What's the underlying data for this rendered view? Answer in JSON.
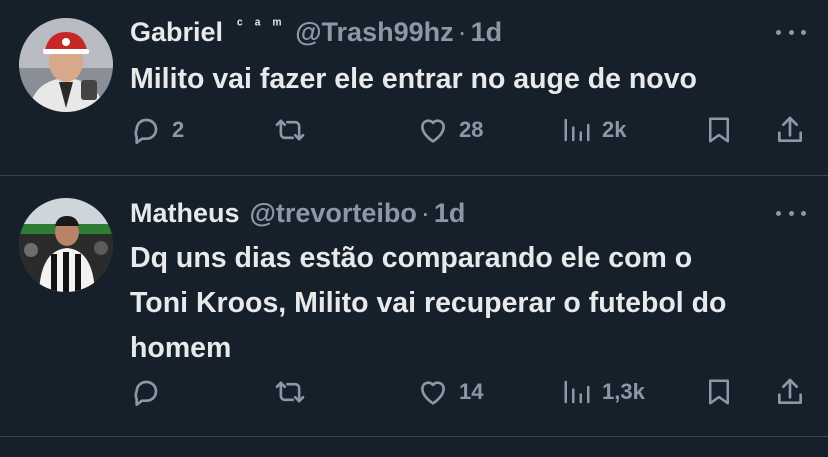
{
  "tweets": [
    {
      "name": "Gabriel",
      "badge": "ᶜ ᵃ ᵐ",
      "handle": "@Trash99hz",
      "separator": "·",
      "time": "1d",
      "text": "Milito vai fazer ele entrar no auge de novo",
      "replies": "2",
      "retweets": "",
      "likes": "28",
      "views": "2k"
    },
    {
      "name": "Matheus",
      "handle": "@trevorteibo",
      "separator": "·",
      "time": "1d",
      "text_lines": [
        "Dq uns dias estão comparando ele com o",
        "Toni Kroos, Milito vai recuperar o futebol do",
        "homem"
      ],
      "replies": "",
      "retweets": "",
      "likes": "14",
      "views": "1,3k"
    }
  ],
  "icons": [
    "reply-icon",
    "retweet-icon",
    "like-icon",
    "views-icon",
    "bookmark-icon",
    "share-icon",
    "more-icon"
  ],
  "colors": {
    "background": "#15202b",
    "text": "#e7e9ea",
    "muted": "#8b98a5",
    "divider": "#38444d"
  }
}
